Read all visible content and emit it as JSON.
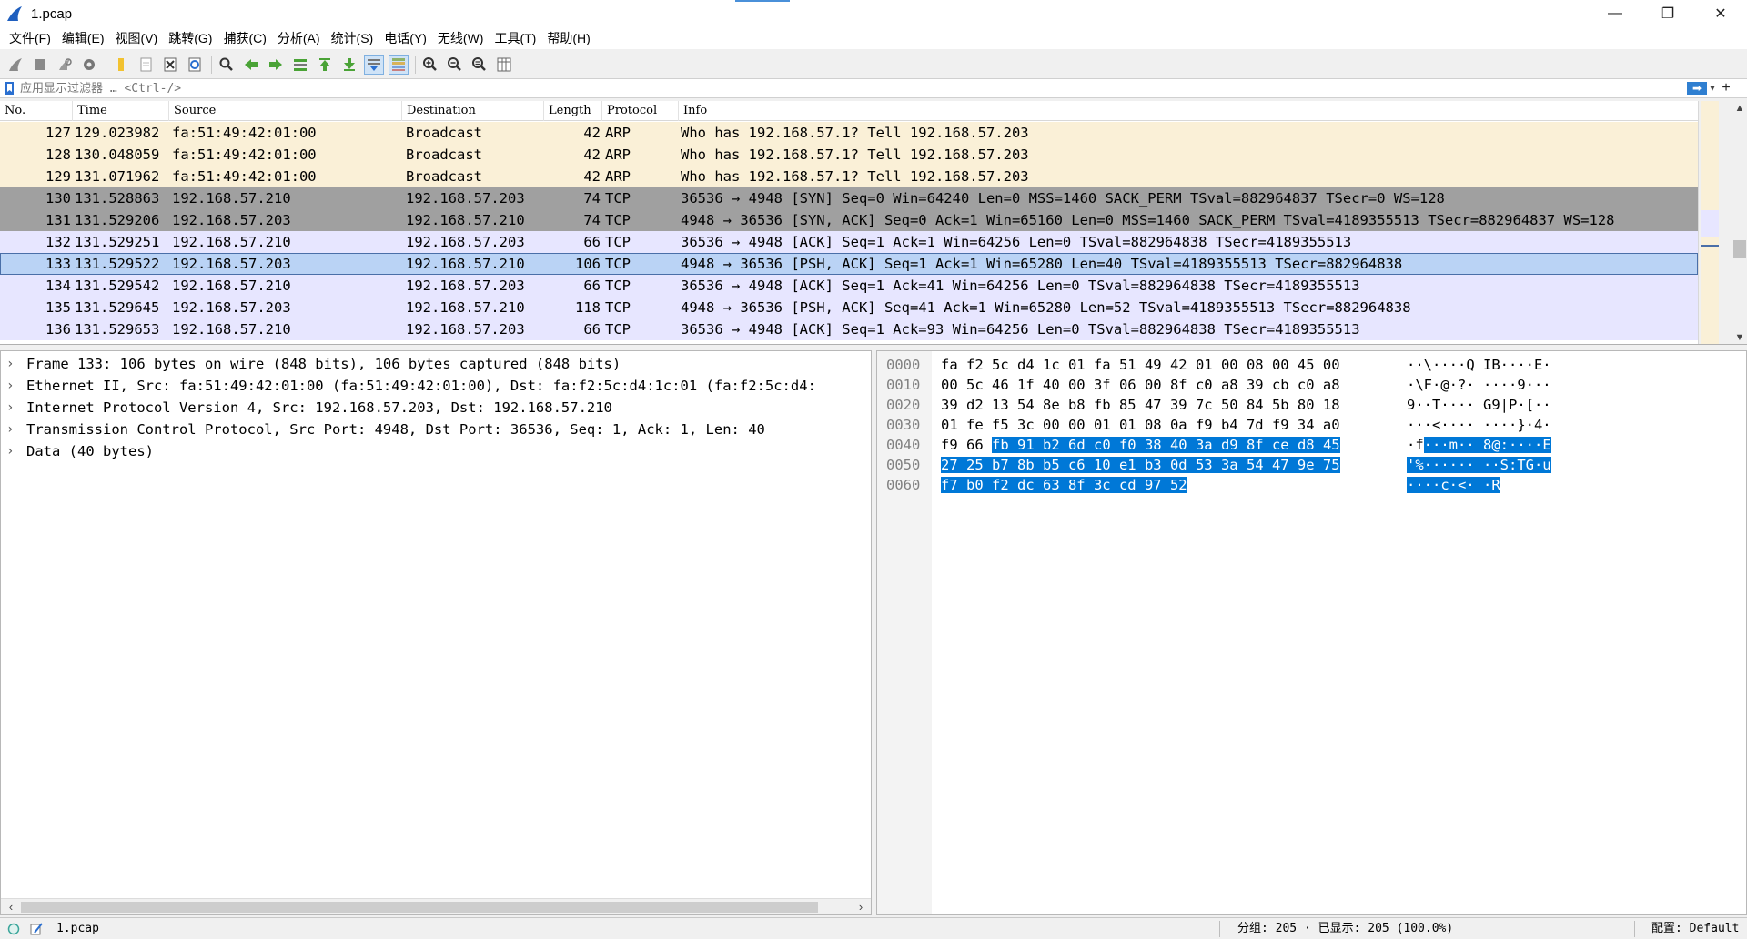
{
  "window": {
    "title": "1.pcap",
    "controls": [
      "—",
      "❐",
      "✕"
    ]
  },
  "menu": [
    "文件(F)",
    "编辑(E)",
    "视图(V)",
    "跳转(G)",
    "捕获(C)",
    "分析(A)",
    "统计(S)",
    "电话(Y)",
    "无线(W)",
    "工具(T)",
    "帮助(H)"
  ],
  "toolbar": {
    "icons": [
      "shark-fin-start-icon",
      "stop-icon",
      "restart-icon",
      "options-gear-icon",
      "open-folder-icon",
      "file-icon",
      "close-file-icon",
      "reload-icon",
      "find-icon",
      "back-arrow-icon",
      "forward-arrow-icon",
      "goto-packet-icon",
      "first-packet-icon",
      "last-packet-icon",
      "autoscroll-icon",
      "colorize-icon",
      "zoom-in-icon",
      "zoom-out-icon",
      "zoom-reset-icon",
      "resize-columns-icon"
    ]
  },
  "filter": {
    "placeholder": "应用显示过滤器 … <Ctrl-/>",
    "apply_label": "➡",
    "dropdown_label": "▾",
    "add_label": "+"
  },
  "packet_list": {
    "columns": [
      "No.",
      "Time",
      "Source",
      "Destination",
      "Length",
      "Protocol",
      "Info"
    ],
    "rows": [
      {
        "no": "127",
        "time": "129.023982",
        "src": "fa:51:49:42:01:00",
        "dst": "Broadcast",
        "len": "42",
        "proto": "ARP",
        "info": "Who has 192.168.57.1? Tell 192.168.57.203",
        "style": "arp"
      },
      {
        "no": "128",
        "time": "130.048059",
        "src": "fa:51:49:42:01:00",
        "dst": "Broadcast",
        "len": "42",
        "proto": "ARP",
        "info": "Who has 192.168.57.1? Tell 192.168.57.203",
        "style": "arp"
      },
      {
        "no": "129",
        "time": "131.071962",
        "src": "fa:51:49:42:01:00",
        "dst": "Broadcast",
        "len": "42",
        "proto": "ARP",
        "info": "Who has 192.168.57.1? Tell 192.168.57.203",
        "style": "arp"
      },
      {
        "no": "130",
        "time": "131.528863",
        "src": "192.168.57.210",
        "dst": "192.168.57.203",
        "len": "74",
        "proto": "TCP",
        "info": "36536 → 4948 [SYN] Seq=0 Win=64240 Len=0 MSS=1460 SACK_PERM TSval=882964837 TSecr=0 WS=128",
        "style": "syn"
      },
      {
        "no": "131",
        "time": "131.529206",
        "src": "192.168.57.203",
        "dst": "192.168.57.210",
        "len": "74",
        "proto": "TCP",
        "info": "4948 → 36536 [SYN, ACK] Seq=0 Ack=1 Win=65160 Len=0 MSS=1460 SACK_PERM TSval=4189355513 TSecr=882964837 WS=128",
        "style": "syn"
      },
      {
        "no": "132",
        "time": "131.529251",
        "src": "192.168.57.210",
        "dst": "192.168.57.203",
        "len": "66",
        "proto": "TCP",
        "info": "36536 → 4948 [ACK] Seq=1 Ack=1 Win=64256 Len=0 TSval=882964838 TSecr=4189355513",
        "style": "tcp"
      },
      {
        "no": "133",
        "time": "131.529522",
        "src": "192.168.57.203",
        "dst": "192.168.57.210",
        "len": "106",
        "proto": "TCP",
        "info": "4948 → 36536 [PSH, ACK] Seq=1 Ack=1 Win=65280 Len=40 TSval=4189355513 TSecr=882964838",
        "style": "selected"
      },
      {
        "no": "134",
        "time": "131.529542",
        "src": "192.168.57.210",
        "dst": "192.168.57.203",
        "len": "66",
        "proto": "TCP",
        "info": "36536 → 4948 [ACK] Seq=1 Ack=41 Win=64256 Len=0 TSval=882964838 TSecr=4189355513",
        "style": "tcp"
      },
      {
        "no": "135",
        "time": "131.529645",
        "src": "192.168.57.203",
        "dst": "192.168.57.210",
        "len": "118",
        "proto": "TCP",
        "info": "4948 → 36536 [PSH, ACK] Seq=41 Ack=1 Win=65280 Len=52 TSval=4189355513 TSecr=882964838",
        "style": "tcp"
      },
      {
        "no": "136",
        "time": "131.529653",
        "src": "192.168.57.210",
        "dst": "192.168.57.203",
        "len": "66",
        "proto": "TCP",
        "info": "36536 → 4948 [ACK] Seq=1 Ack=93 Win=64256 Len=0 TSval=882964838 TSecr=4189355513",
        "style": "tcp"
      }
    ],
    "scroll_up": "▲",
    "scroll_down": "▼"
  },
  "row_colors": {
    "arp": "#faf0d7",
    "syn": "#a0a0a0",
    "tcp": "#e7e6ff",
    "selected": "#bad3f5",
    "selected_border": "#4a6fa8"
  },
  "details": {
    "rows": [
      "Frame 133: 106 bytes on wire (848 bits), 106 bytes captured (848 bits)",
      "Ethernet II, Src: fa:51:49:42:01:00 (fa:51:49:42:01:00), Dst: fa:f2:5c:d4:1c:01 (fa:f2:5c:d4:",
      "Internet Protocol Version 4, Src: 192.168.57.203, Dst: 192.168.57.210",
      "Transmission Control Protocol, Src Port: 4948, Dst Port: 36536, Seq: 1, Ack: 1, Len: 40",
      "Data (40 bytes)"
    ],
    "chevron": "›",
    "scroll_left": "‹",
    "scroll_right": "›"
  },
  "bytes": {
    "rows": [
      {
        "offset": "0000",
        "hex_plain": "fa f2 5c d4 1c 01 fa 51  49 42 01 00 08 00 45 00",
        "hex_hl": "",
        "ascii_plain": "··\\····Q IB····E·",
        "ascii_hl": ""
      },
      {
        "offset": "0010",
        "hex_plain": "00 5c 46 1f 40 00 3f 06  00 8f c0 a8 39 cb c0 a8",
        "hex_hl": "",
        "ascii_plain": "·\\F·@·?·  ····9···",
        "ascii_hl": ""
      },
      {
        "offset": "0020",
        "hex_plain": "39 d2 13 54 8e b8 fb 85  47 39 7c 50 84 5b 80 18",
        "hex_hl": "",
        "ascii_plain": "9··T···· G9|P·[··",
        "ascii_hl": ""
      },
      {
        "offset": "0030",
        "hex_plain": "01 fe f5 3c 00 00 01 01  08 0a f9 b4 7d f9 34 a0",
        "hex_hl": "",
        "ascii_plain": "···<···· ····}·4·",
        "ascii_hl": ""
      },
      {
        "offset": "0040",
        "hex_plain": "f9 66 ",
        "hex_hl": "fb 91 b2 6d c0 f0  38 40 3a d9 8f ce d8 45",
        "ascii_plain": "·f",
        "ascii_hl": "···m·· 8@:····E"
      },
      {
        "offset": "0050",
        "hex_plain": "",
        "hex_hl": "27 25 b7 8b b5 c6 10 e1  b3 0d 53 3a 54 47 9e 75",
        "ascii_plain": "",
        "ascii_hl": "'%······ ··S:TG·u"
      },
      {
        "offset": "0060",
        "hex_plain": "",
        "hex_hl": "f7 b0 f2 dc 63 8f 3c cd  97 52",
        "ascii_plain": "",
        "ascii_hl": "····c·<· ·R"
      }
    ]
  },
  "status": {
    "file": "1.pcap",
    "packets": "分组: 205 · 已显示: 205 (100.0%)",
    "profile": "配置: Default"
  }
}
